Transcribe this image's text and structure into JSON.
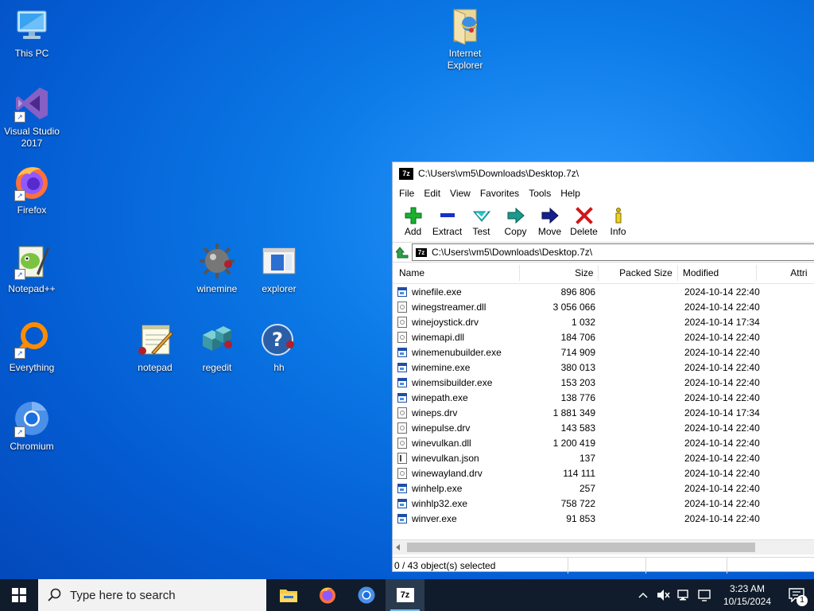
{
  "desktop": {
    "icons": [
      {
        "label": "This PC"
      },
      {
        "label": "Visual Studio 2017"
      },
      {
        "label": "Firefox"
      },
      {
        "label": "Notepad++"
      },
      {
        "label": "Everything"
      },
      {
        "label": "Chromium"
      },
      {
        "label": "Internet Explorer"
      },
      {
        "label": "winemine"
      },
      {
        "label": "explorer"
      },
      {
        "label": "notepad"
      },
      {
        "label": "regedit"
      },
      {
        "label": "hh"
      }
    ]
  },
  "window": {
    "title": "C:\\Users\\vm5\\Downloads\\Desktop.7z\\",
    "app_badge": "7z",
    "menu": [
      "File",
      "Edit",
      "View",
      "Favorites",
      "Tools",
      "Help"
    ],
    "toolbar": [
      "Add",
      "Extract",
      "Test",
      "Copy",
      "Move",
      "Delete",
      "Info"
    ],
    "address": "C:\\Users\\vm5\\Downloads\\Desktop.7z\\",
    "columns": [
      "Name",
      "Size",
      "Packed Size",
      "Modified",
      "Attri"
    ],
    "files": [
      {
        "name": "winefile.exe",
        "size": "896 806",
        "modified": "2024-10-14 22:40",
        "type": "exe"
      },
      {
        "name": "winegstreamer.dll",
        "size": "3 056 066",
        "modified": "2024-10-14 22:40",
        "type": "dll"
      },
      {
        "name": "winejoystick.drv",
        "size": "1 032",
        "modified": "2024-10-14 17:34",
        "type": "dll"
      },
      {
        "name": "winemapi.dll",
        "size": "184 706",
        "modified": "2024-10-14 22:40",
        "type": "dll"
      },
      {
        "name": "winemenubuilder.exe",
        "size": "714 909",
        "modified": "2024-10-14 22:40",
        "type": "exe"
      },
      {
        "name": "winemine.exe",
        "size": "380 013",
        "modified": "2024-10-14 22:40",
        "type": "exe"
      },
      {
        "name": "winemsibuilder.exe",
        "size": "153 203",
        "modified": "2024-10-14 22:40",
        "type": "exe"
      },
      {
        "name": "winepath.exe",
        "size": "138 776",
        "modified": "2024-10-14 22:40",
        "type": "exe"
      },
      {
        "name": "wineps.drv",
        "size": "1 881 349",
        "modified": "2024-10-14 17:34",
        "type": "dll"
      },
      {
        "name": "winepulse.drv",
        "size": "143 583",
        "modified": "2024-10-14 22:40",
        "type": "dll"
      },
      {
        "name": "winevulkan.dll",
        "size": "1 200 419",
        "modified": "2024-10-14 22:40",
        "type": "dll"
      },
      {
        "name": "winevulkan.json",
        "size": "137",
        "modified": "2024-10-14 22:40",
        "type": "json"
      },
      {
        "name": "winewayland.drv",
        "size": "114 111",
        "modified": "2024-10-14 22:40",
        "type": "dll"
      },
      {
        "name": "winhelp.exe",
        "size": "257",
        "modified": "2024-10-14 22:40",
        "type": "exe"
      },
      {
        "name": "winhlp32.exe",
        "size": "758 722",
        "modified": "2024-10-14 22:40",
        "type": "exe"
      },
      {
        "name": "winver.exe",
        "size": "91 853",
        "modified": "2024-10-14 22:40",
        "type": "exe"
      }
    ],
    "status": "0 / 43 object(s) selected"
  },
  "taskbar": {
    "search_placeholder": "Type here to search",
    "time": "3:23 AM",
    "date": "10/15/2024",
    "notification_count": "1",
    "app_badge": "7z"
  }
}
